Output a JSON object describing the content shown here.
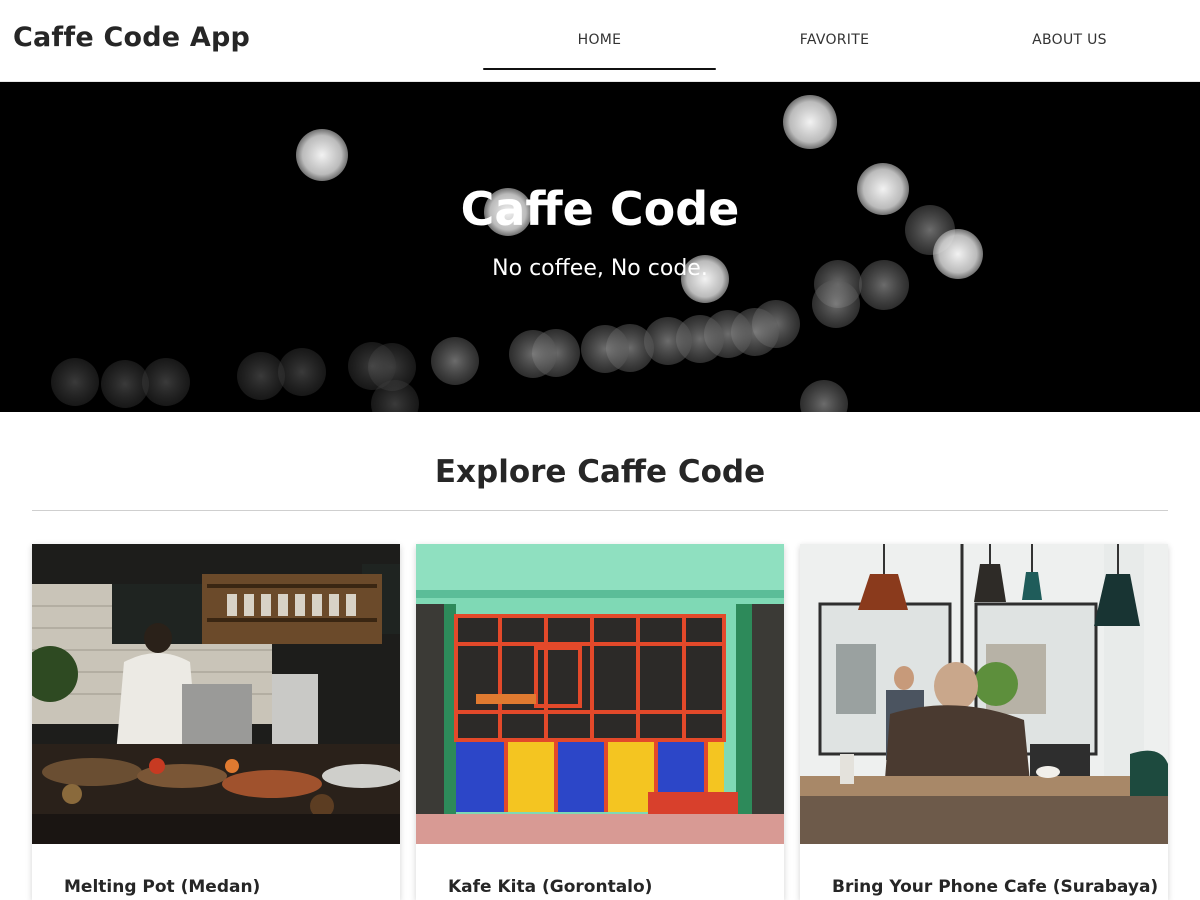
{
  "header": {
    "app_title": "Caffe Code App",
    "nav": [
      {
        "label": "HOME",
        "active": true
      },
      {
        "label": "FAVORITE",
        "active": false
      },
      {
        "label": "ABOUT US",
        "active": false
      }
    ]
  },
  "hero": {
    "title": "Caffe Code",
    "subtitle": "No coffee, No code.",
    "background": "black-and-white bokeh lights"
  },
  "explore": {
    "title": "Explore Caffe Code",
    "cards": [
      {
        "name": "Melting Pot (Medan)",
        "image": "cafe-counter-photo"
      },
      {
        "name": "Kafe Kita (Gorontalo)",
        "image": "colorful-storefront-photo"
      },
      {
        "name": "Bring Your Phone Cafe (Surabaya)",
        "image": "cafe-interior-photo"
      }
    ]
  },
  "colors": {
    "text": "#262626",
    "hero_bg": "#000000",
    "page_bg": "#ffffff"
  }
}
